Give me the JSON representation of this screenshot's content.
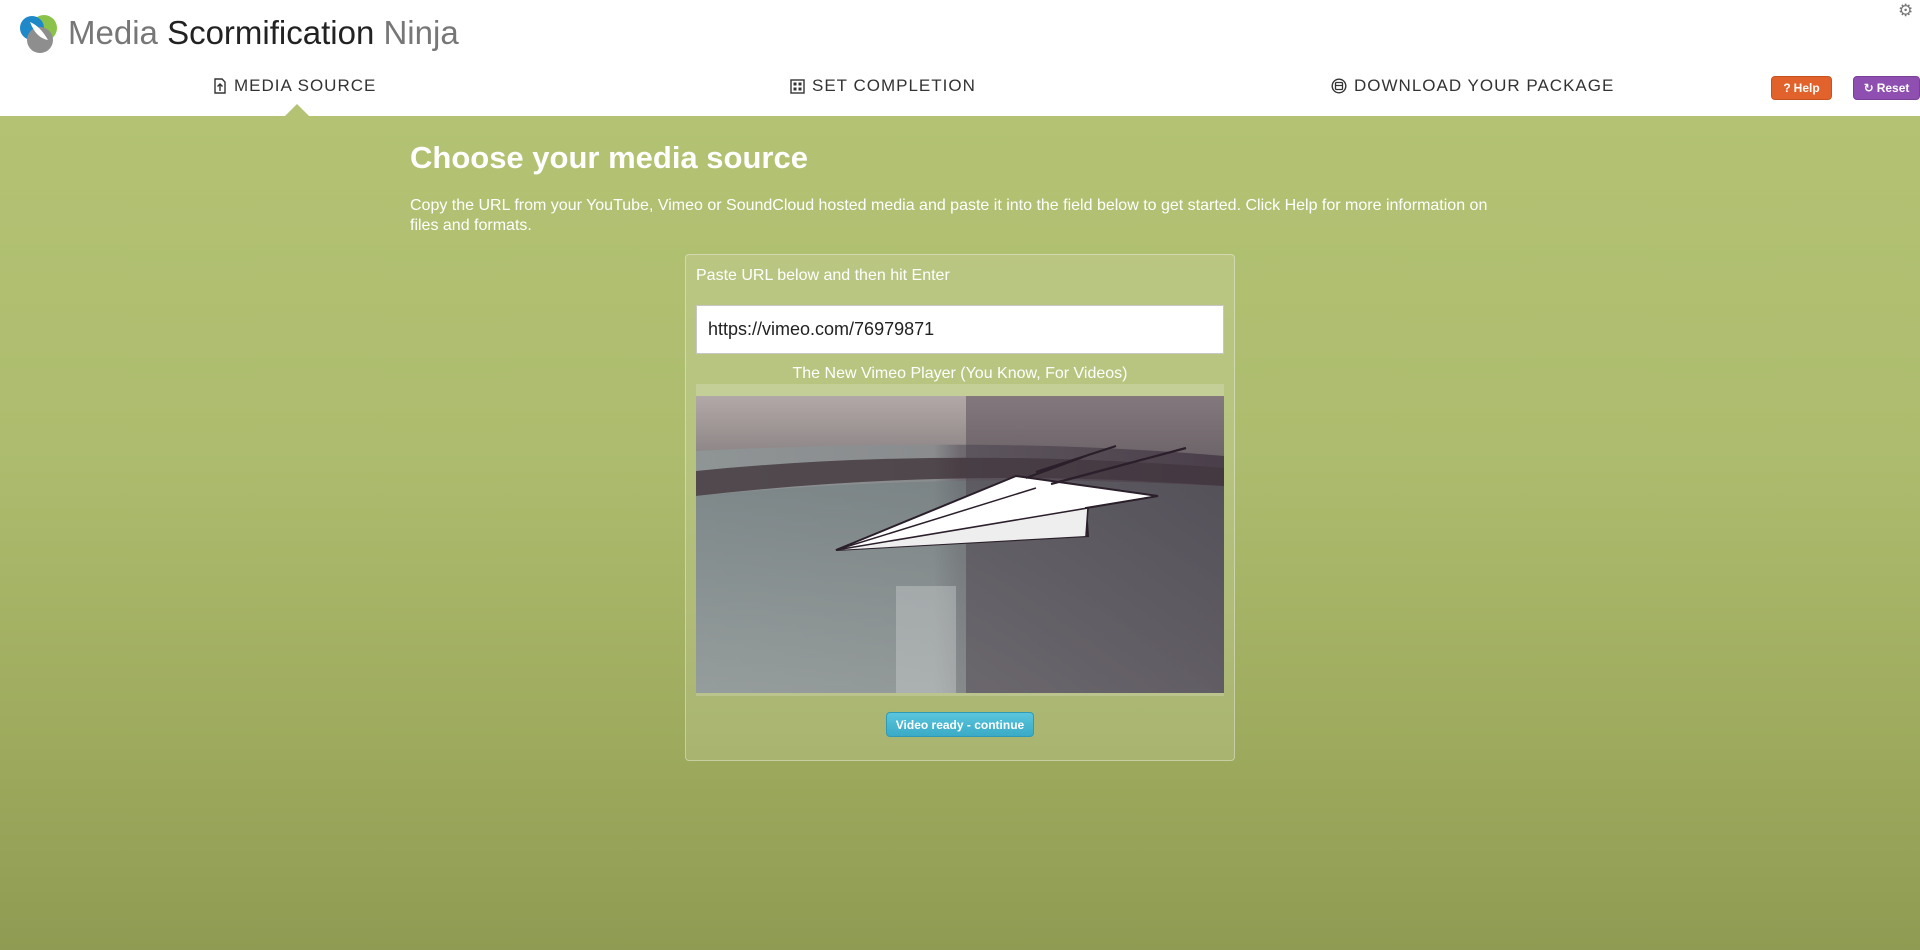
{
  "app": {
    "title_part1": "Media",
    "title_part2": "Scormification",
    "title_part3": "Ninja"
  },
  "nav": {
    "items": [
      {
        "label": "MEDIA SOURCE",
        "icon": "upload-file-icon",
        "active": true
      },
      {
        "label": "SET COMPLETION",
        "icon": "calculator-icon",
        "active": false
      },
      {
        "label": "DOWNLOAD YOUR PACKAGE",
        "icon": "package-icon",
        "active": false
      }
    ]
  },
  "actions": {
    "help_label": "Help",
    "reset_label": "Reset",
    "help_color": "#e2622b",
    "reset_color": "#8e4fb0"
  },
  "main": {
    "heading": "Choose your media source",
    "intro": "Copy the URL from your YouTube, Vimeo or SoundCloud hosted media and paste it into the field below to get started. Click Help for more information on files and formats.",
    "panel_label": "Paste URL below and then hit Enter",
    "url_value": "https://vimeo.com/76979871",
    "video_title": "The New Vimeo Player (You Know, For Videos)",
    "continue_label": "Video ready - continue",
    "background_color": "#b3c273",
    "button_color": "#3aaac6"
  }
}
